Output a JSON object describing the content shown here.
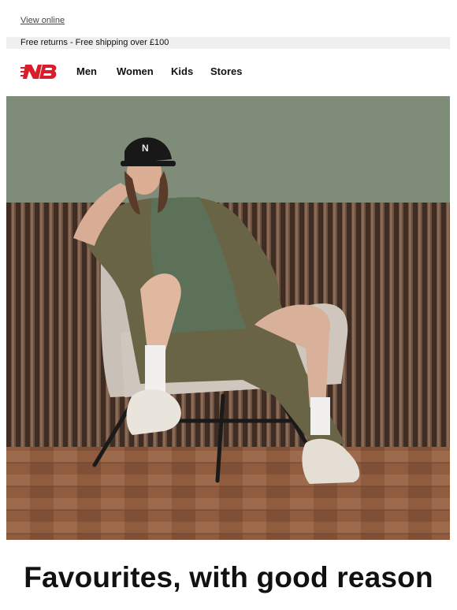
{
  "header": {
    "view_online": "View online"
  },
  "promo": {
    "text": "Free returns - Free shipping over £100"
  },
  "nav": {
    "logo_icon": "new-balance-logo-icon",
    "items": [
      {
        "label": "Men"
      },
      {
        "label": "Women"
      },
      {
        "label": "Kids"
      },
      {
        "label": "Stores"
      }
    ]
  },
  "hero": {
    "image": "woman-seated-in-armchair-wearing-cap-and-sneakers",
    "cap_logo": "N",
    "colors": {
      "wall": "#7e8b78",
      "slats": "#5b4334",
      "floor": "#8a5a3f",
      "outfit": "#5d7159",
      "jacket": "#6b6547"
    }
  },
  "headline": {
    "text": "Favourites, with good reason"
  },
  "colors": {
    "brand_red": "#d81e2a",
    "promo_bg": "#efefef",
    "text": "#111111"
  }
}
